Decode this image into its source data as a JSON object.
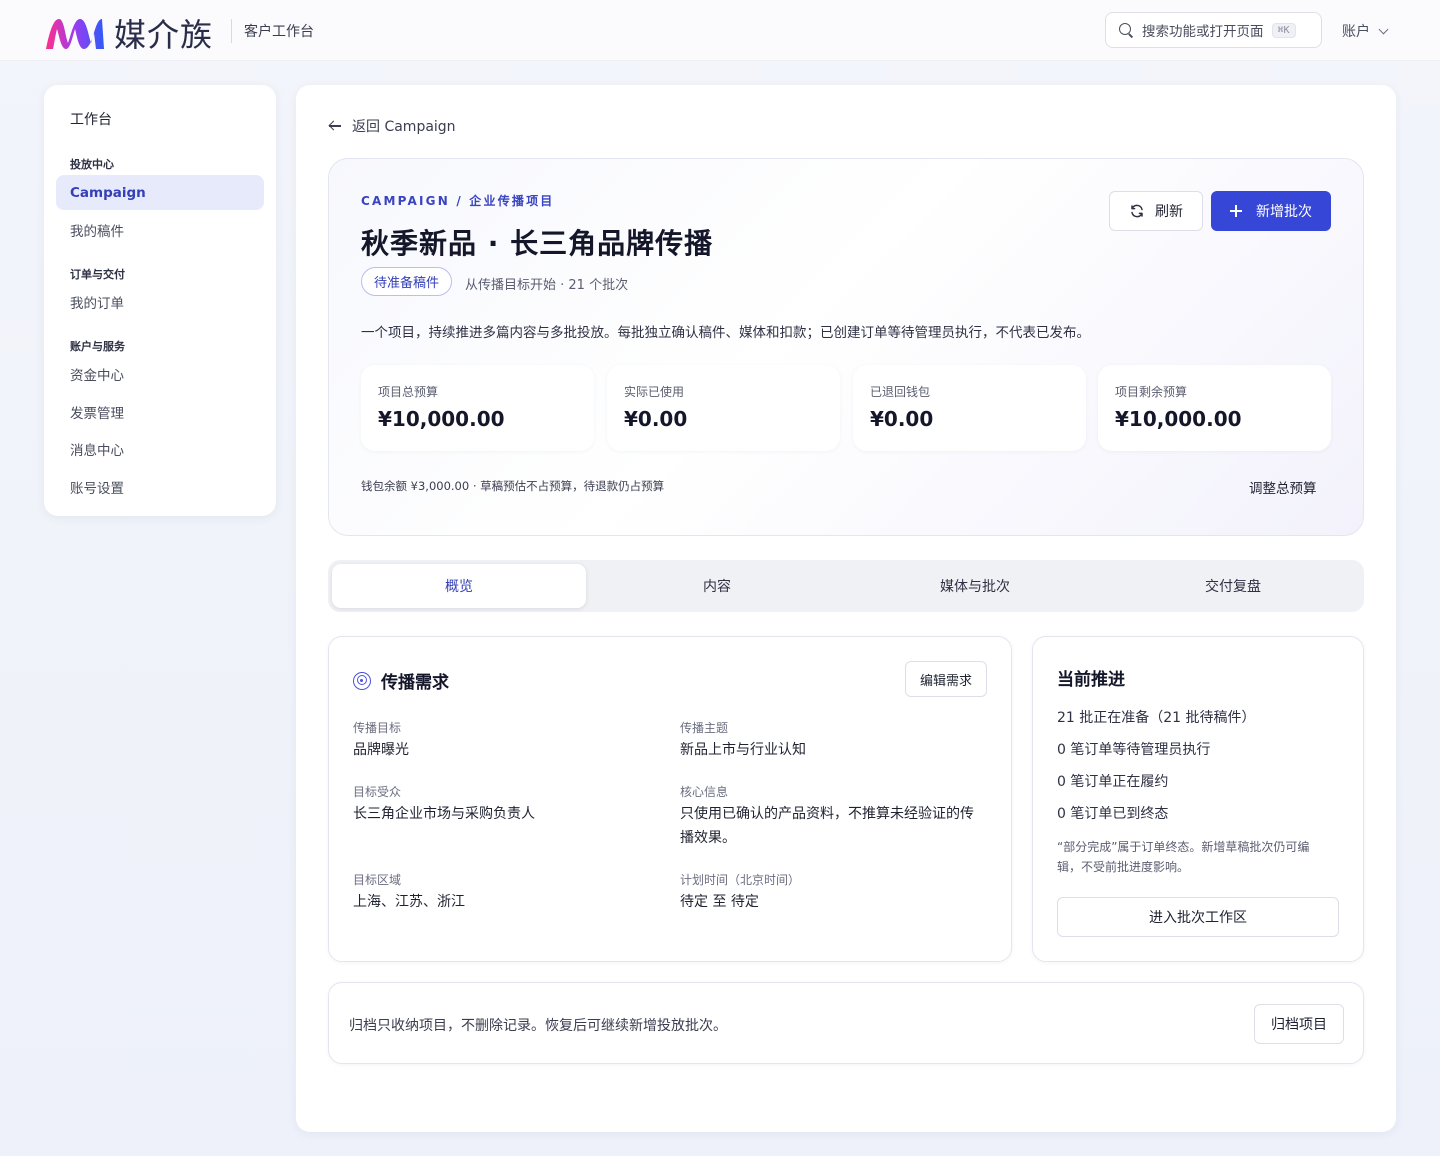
{
  "brand": {
    "name": "媒介族",
    "subtitle": "客户工作台",
    "colors": {
      "logo_gradient_start": "#ff3a7a",
      "logo_gradient_end": "#3a5cf5"
    }
  },
  "header": {
    "search": {
      "placeholder": "搜索功能或打开页面",
      "shortcut": "⌘K"
    },
    "account_label": "账户"
  },
  "sidebar": {
    "title": "工作台",
    "groups": [
      {
        "label": "投放中心",
        "items": [
          {
            "label": "Campaign",
            "active": true
          },
          {
            "label": "我的稿件",
            "active": false
          }
        ]
      },
      {
        "label": "订单与交付",
        "items": [
          {
            "label": "我的订单",
            "active": false
          }
        ]
      },
      {
        "label": "账户与服务",
        "items": [
          {
            "label": "资金中心",
            "active": false
          },
          {
            "label": "发票管理",
            "active": false
          },
          {
            "label": "消息中心",
            "active": false
          },
          {
            "label": "账号设置",
            "active": false
          }
        ]
      }
    ]
  },
  "main": {
    "back_label": "返回 Campaign",
    "hero": {
      "eyebrow": "CAMPAIGN / 企业传播项目",
      "title": "秋季新品 · 长三角品牌传播",
      "status": "待准备稿件",
      "meta": "从传播目标开始 · 21 个批次",
      "description": "一个项目，持续推进多篇内容与多批投放。每批独立确认稿件、媒体和扣款；已创建订单等待管理员执行，不代表已发布。",
      "refresh_label": "刷新",
      "new_batch_label": "新增批次",
      "stats": [
        {
          "label": "项目总预算",
          "value": "¥10,000.00"
        },
        {
          "label": "实际已使用",
          "value": "¥0.00"
        },
        {
          "label": "已退回钱包",
          "value": "¥0.00"
        },
        {
          "label": "项目剩余预算",
          "value": "¥10,000.00"
        }
      ],
      "wallet_note": "钱包余额 ¥3,000.00 · 草稿预估不占预算，待退款仍占预算",
      "adjust_label": "调整总预算"
    },
    "tabs": [
      {
        "label": "概览",
        "active": true
      },
      {
        "label": "内容",
        "active": false
      },
      {
        "label": "媒体与批次",
        "active": false
      },
      {
        "label": "交付复盘",
        "active": false
      }
    ],
    "requirements": {
      "title": "传播需求",
      "edit_label": "编辑需求",
      "fields": {
        "goal": {
          "label": "传播目标",
          "value": "品牌曝光"
        },
        "theme": {
          "label": "传播主题",
          "value": "新品上市与行业认知"
        },
        "audience": {
          "label": "目标受众",
          "value": "长三角企业市场与采购负责人"
        },
        "message": {
          "label": "核心信息",
          "value": "只使用已确认的产品资料，不推算未经验证的传播效果。"
        },
        "region": {
          "label": "目标区域",
          "value": "上海、江苏、浙江"
        },
        "schedule": {
          "label": "计划时间（北京时间）",
          "value": "待定 至 待定"
        }
      }
    },
    "progress": {
      "title": "当前推进",
      "lines": [
        "21 批正在准备（21 批待稿件）",
        "0 笔订单等待管理员执行",
        "0 笔订单正在履约",
        "0 笔订单已到终态"
      ],
      "note": "“部分完成”属于订单终态。新增草稿批次仍可编辑，不受前批进度影响。",
      "enter_label": "进入批次工作区"
    },
    "archive": {
      "text": "归档只收纳项目，不删除记录。恢复后可继续新增投放批次。",
      "button_label": "归档项目"
    },
    "colors": {
      "accent": "#3646d6",
      "accent_text": "#3440b8"
    }
  }
}
